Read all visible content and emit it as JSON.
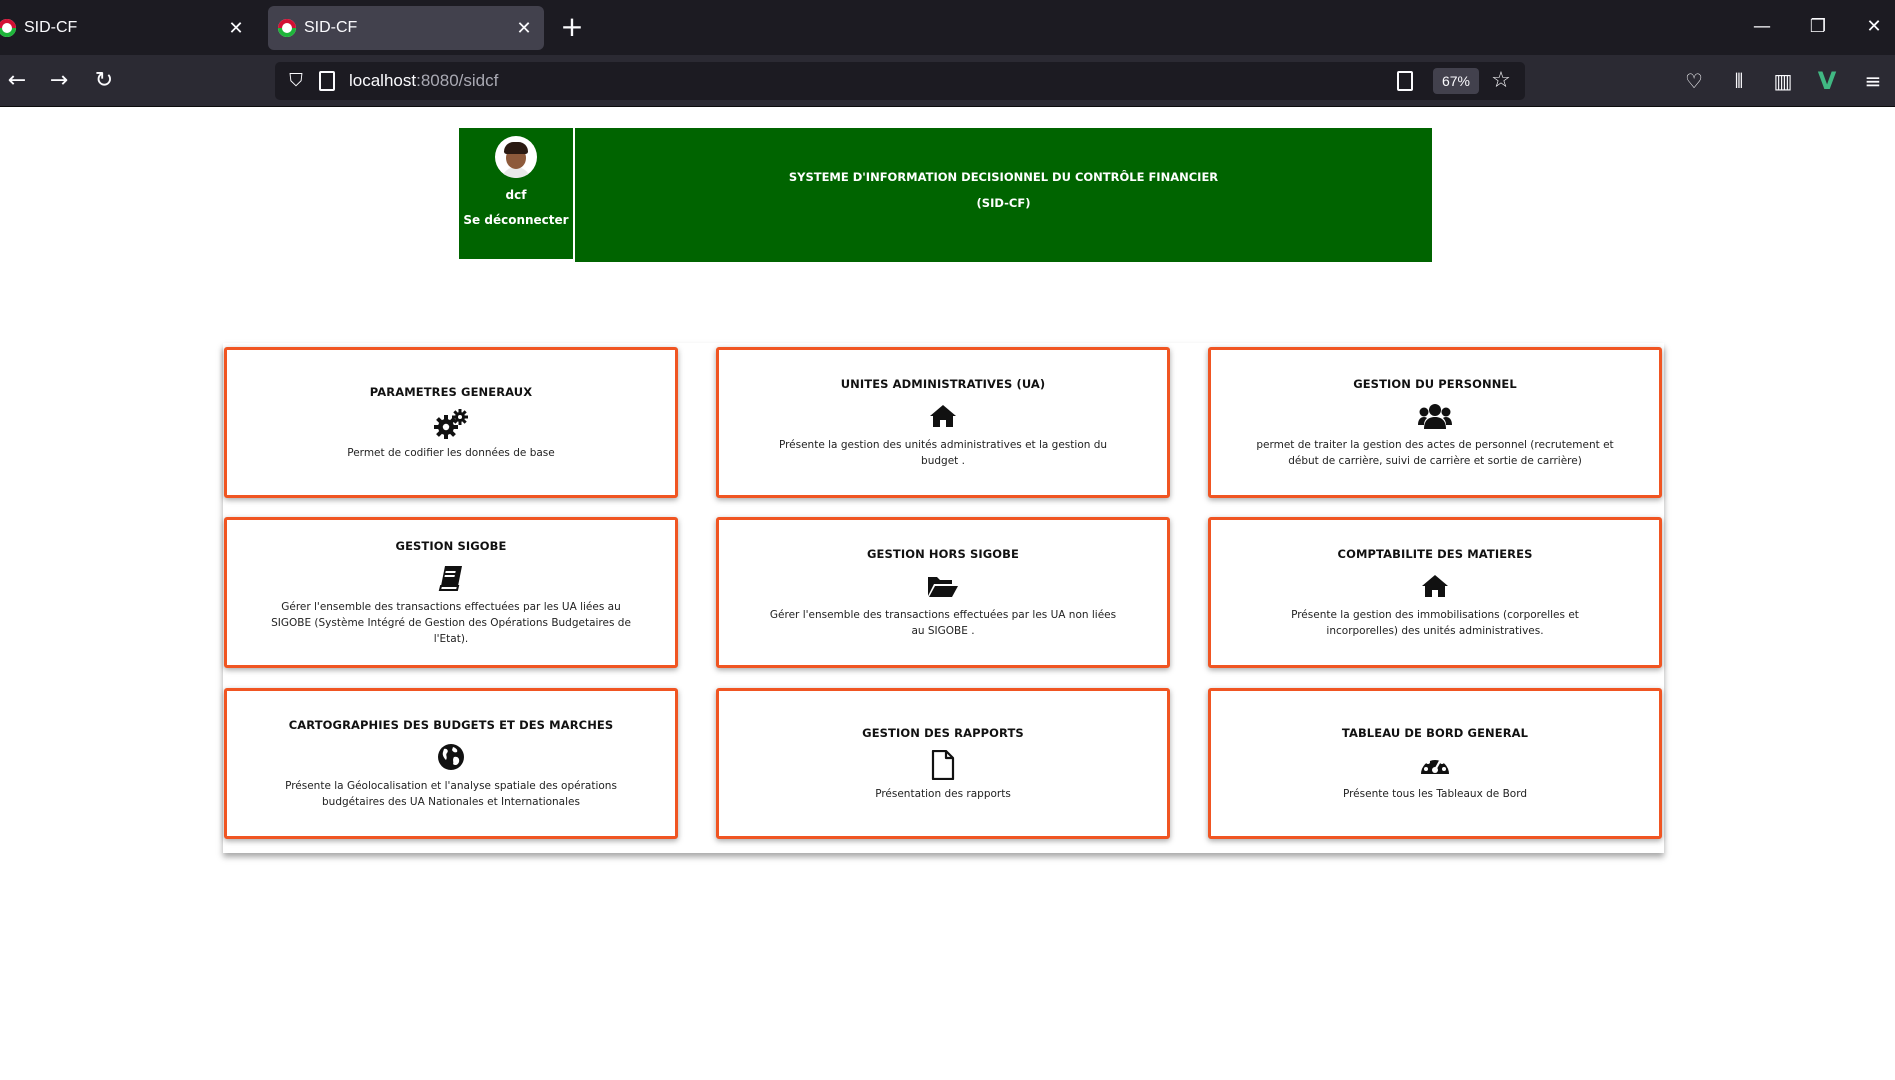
{
  "browser": {
    "tabs": [
      {
        "title": "SID-CF",
        "active": false
      },
      {
        "title": "SID-CF",
        "active": true
      }
    ],
    "url": {
      "host": "localhost",
      "rest": ":8080/sidcf"
    },
    "zoom": "67%"
  },
  "header": {
    "user_name": "dcf",
    "logout_label": "Se déconnecter",
    "title_line1": "SYSTEME D'INFORMATION DECISIONNEL DU CONTRÔLE FINANCIER",
    "title_line2": "(SID-CF)"
  },
  "colors": {
    "brand_green": "#006400",
    "card_border": "#f05522"
  },
  "cards": [
    {
      "title": "PARAMETRES GENERAUX",
      "icon": "cogs-icon",
      "desc": "Permet de codifier les données de base"
    },
    {
      "title": "UNITES ADMINISTRATIVES (UA)",
      "icon": "home-icon",
      "desc": "Présente la gestion des unités administratives et la gestion du budget ."
    },
    {
      "title": "GESTION DU PERSONNEL",
      "icon": "users-icon",
      "desc": "permet de traiter la gestion des actes de personnel (recrutement et début de carrière, suivi de carrière et sortie de carrière)"
    },
    {
      "title": "GESTION SIGOBE",
      "icon": "book-icon",
      "desc": "Gérer l'ensemble des transactions effectuées par les UA liées au SIGOBE (Système Intégré de Gestion des Opérations Budgetaires de l'Etat)."
    },
    {
      "title": "GESTION HORS SIGOBE",
      "icon": "folder-open-icon",
      "desc": "Gérer l'ensemble des transactions effectuées par les UA non liées au SIGOBE ."
    },
    {
      "title": "COMPTABILITE DES MATIERES",
      "icon": "home-icon",
      "desc": "Présente la gestion des immobilisations (corporelles et incorporelles) des unités administratives."
    },
    {
      "title": "CARTOGRAPHIES DES BUDGETS ET DES MARCHES",
      "icon": "globe-icon",
      "desc": "Présente la Géolocalisation et l'analyse spatiale des opérations budgétaires des UA Nationales et Internationales"
    },
    {
      "title": "GESTION DES RAPPORTS",
      "icon": "file-icon",
      "desc": "Présentation des rapports"
    },
    {
      "title": "TABLEAU DE BORD GENERAL",
      "icon": "dashboard-icon",
      "desc": "Présente tous les Tableaux de Bord"
    }
  ]
}
